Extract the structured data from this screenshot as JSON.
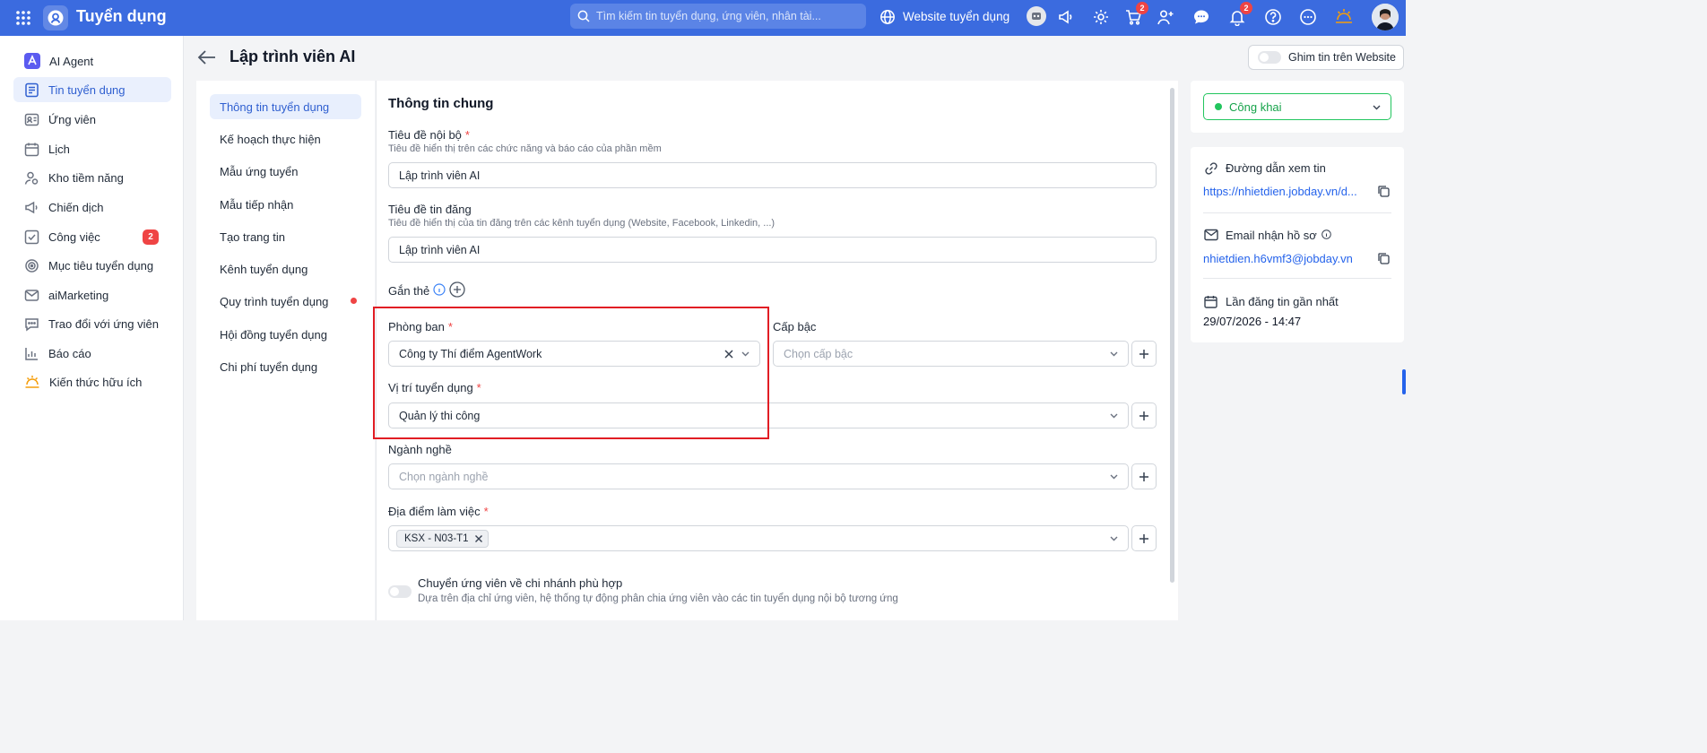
{
  "app": {
    "title": "Tuyển dụng"
  },
  "header": {
    "search_placeholder": "Tìm kiếm tin tuyển dụng, ứng viên, nhân tài...",
    "website_label": "Website tuyển dụng",
    "cart_badge": "2",
    "notification_badge": "2"
  },
  "sidebar": {
    "items": [
      {
        "label": "AI Agent",
        "icon": "ai-agent-icon"
      },
      {
        "label": "Tin tuyển dụng",
        "icon": "job-post-icon"
      },
      {
        "label": "Ứng viên",
        "icon": "candidate-card-icon"
      },
      {
        "label": "Lịch",
        "icon": "calendar-icon"
      },
      {
        "label": "Kho tiềm năng",
        "icon": "talent-pool-icon"
      },
      {
        "label": "Chiến dịch",
        "icon": "megaphone-icon"
      },
      {
        "label": "Công việc",
        "icon": "task-icon",
        "count": "2"
      },
      {
        "label": "Mục tiêu tuyển dụng",
        "icon": "target-icon"
      },
      {
        "label": "aiMarketing",
        "icon": "mail-icon"
      },
      {
        "label": "Trao đổi với ứng viên",
        "icon": "chat-icon"
      },
      {
        "label": "Báo cáo",
        "icon": "report-icon"
      },
      {
        "label": "Kiến thức hữu ích",
        "icon": "knowledge-icon"
      }
    ]
  },
  "page": {
    "title": "Lập trình viên AI",
    "pin_label": "Ghim tin trên Website"
  },
  "subnav": {
    "items": [
      {
        "label": "Thông tin tuyển dụng"
      },
      {
        "label": "Kế hoạch thực hiện"
      },
      {
        "label": "Mẫu ứng tuyển"
      },
      {
        "label": "Mẫu tiếp nhận"
      },
      {
        "label": "Tạo trang tin"
      },
      {
        "label": "Kênh tuyển dụng"
      },
      {
        "label": "Quy trình tuyển dụng"
      },
      {
        "label": "Hội đồng tuyển dụng"
      },
      {
        "label": "Chi phí tuyển dụng"
      }
    ]
  },
  "form": {
    "section_title": "Thông tin chung",
    "internal_title": {
      "label": "Tiêu đề nội bộ",
      "hint": "Tiêu đề hiển thị trên các chức năng và báo cáo của phần mềm",
      "value": "Lập trình viên AI"
    },
    "post_title": {
      "label": "Tiêu đề tin đăng",
      "hint": "Tiêu đề hiển thị của tin đăng trên các kênh tuyển dụng (Website, Facebook, Linkedin, ...)",
      "value": "Lập trình viên AI"
    },
    "tags_label": "Gắn thẻ",
    "department": {
      "label": "Phòng ban",
      "value": "Công ty Thí điểm AgentWork"
    },
    "level": {
      "label": "Cấp bậc",
      "placeholder": "Chọn cấp bậc"
    },
    "position": {
      "label": "Vị trí tuyển dụng",
      "value": "Quản lý thi công"
    },
    "industry": {
      "label": "Ngành nghề",
      "placeholder": "Chọn ngành nghề"
    },
    "location": {
      "label": "Địa điểm làm việc",
      "tag": "KSX - N03-T1"
    },
    "transfer": {
      "label": "Chuyển ứng viên về chi nhánh phù hợp",
      "hint": "Dựa trên địa chỉ ứng viên, hệ thống tự động phân chia ứng viên vào các tin tuyển dụng nội bộ tương ứng"
    }
  },
  "right_panel": {
    "status": "Công khai",
    "status_color": "#22c55e",
    "view_link_label": "Đường dẫn xem tin",
    "view_link_url": "https://nhietdien.jobday.vn/d...",
    "email_label": "Email nhận hồ sơ",
    "email_value": "nhietdien.h6vmf3@jobday.vn",
    "last_post_label": "Lần đăng tin gần nhất",
    "last_post_value": "29/07/2026 - 14:47"
  },
  "colors": {
    "brand": "#3b6bdf",
    "highlight": "#e11d24",
    "badge": "#ef4444"
  }
}
